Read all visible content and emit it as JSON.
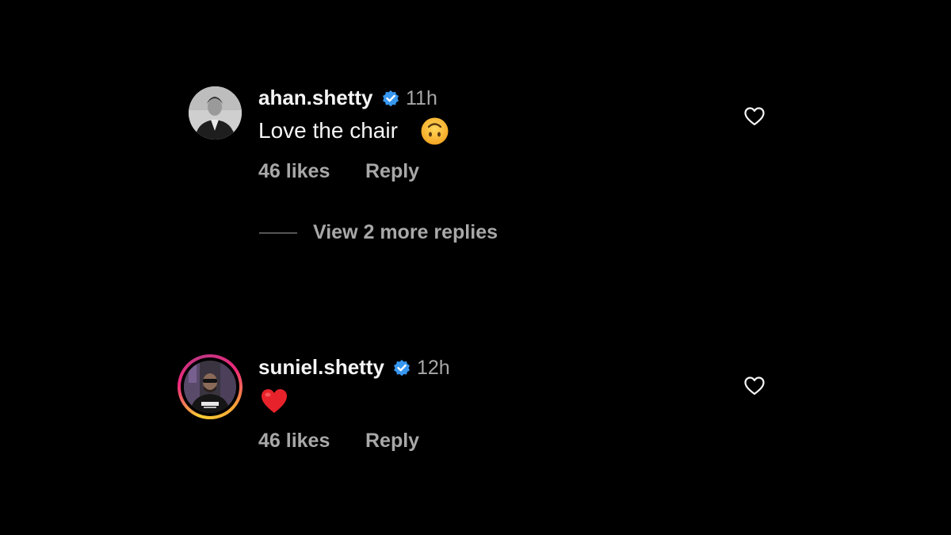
{
  "comments": [
    {
      "username": "ahan.shetty",
      "verified": true,
      "time": "11h",
      "text": "Love the chair",
      "emoji": "upside-down-face",
      "likes": "46 likes",
      "reply_label": "Reply",
      "view_replies": "View 2 more replies",
      "avatar": "grayscale-profile-photo"
    },
    {
      "username": "suniel.shetty",
      "verified": true,
      "time": "12h",
      "emoji": "red-heart",
      "likes": "46 likes",
      "reply_label": "Reply",
      "avatar": "story-ring-profile-photo"
    }
  ],
  "colors": {
    "background": "#000000",
    "primary_text": "#f5f5f5",
    "secondary_text": "#a8a8a8",
    "verified_badge": "#3897f0"
  },
  "icons": {
    "like": "heart-outline-icon",
    "verified": "verified-badge-icon"
  }
}
